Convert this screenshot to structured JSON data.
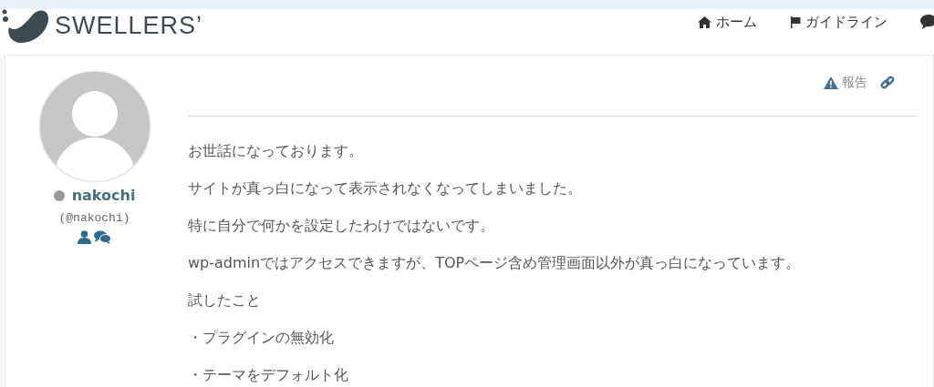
{
  "header": {
    "logo": "SWELLERS’",
    "nav": [
      {
        "kind": "home",
        "label": "ホーム"
      },
      {
        "kind": "flag",
        "label": "ガイドライン"
      },
      {
        "kind": "comment"
      }
    ]
  },
  "post": {
    "actions": [
      {
        "kind": "report",
        "label": "報告"
      },
      {
        "kind": "link"
      }
    ],
    "author": {
      "name": "nakochi",
      "handle": "(@nakochi)",
      "online": false
    },
    "paragraphs": [
      "お世話になっております。",
      "サイトが真っ白になって表示されなくなってしまいました。",
      "特に自分で何かを設定したわけではないです。",
      "wp-adminではアクセスできますが、TOPページ含め管理画面以外が真っ白になっています。",
      "試したこと",
      "・プラグインの無効化",
      "・テーマをデフォルト化"
    ]
  }
}
